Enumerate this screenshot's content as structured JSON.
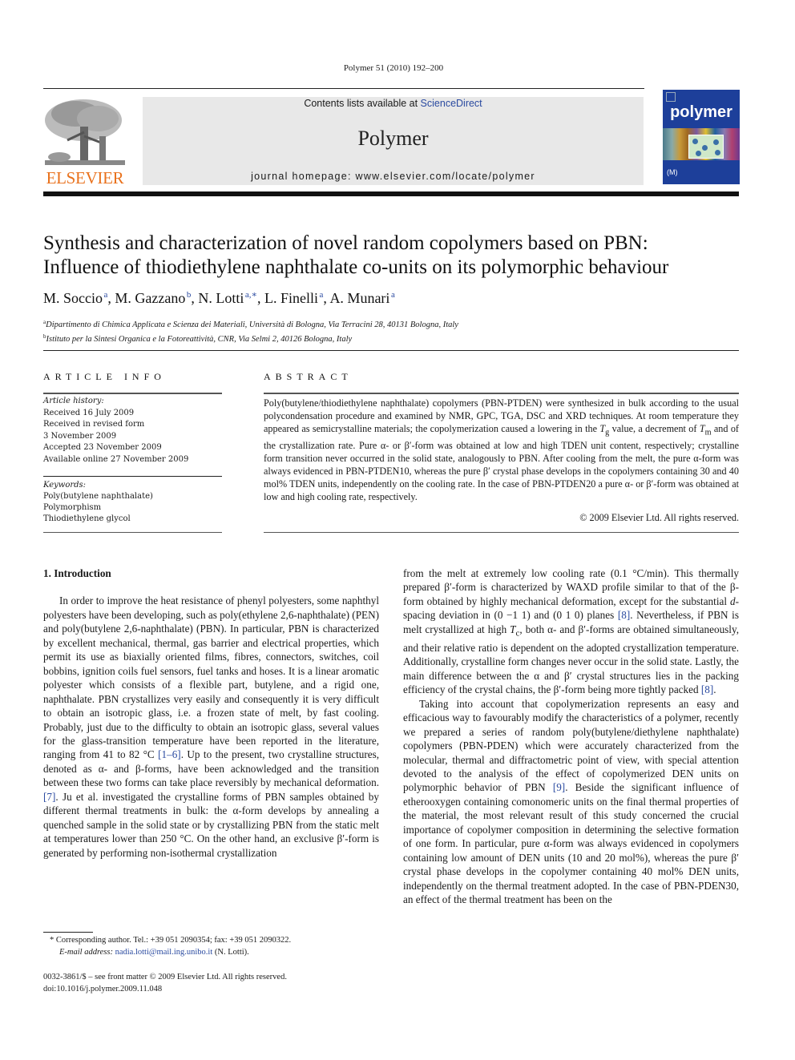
{
  "header": {
    "citation": "Polymer 51 (2010) 192–200",
    "contents_prefix": "Contents lists available at ",
    "contents_link": "ScienceDirect",
    "journal_name": "Polymer",
    "homepage": "journal homepage: www.elsevier.com/locate/polymer",
    "publisher_logo_text": "ELSEVIER",
    "cover_title": "polymer",
    "cover_foot": "(M)"
  },
  "colors": {
    "link": "#2a4aa0",
    "elsevier_orange": "#e9711c",
    "banner_bg": "#e8e8e8",
    "cover_blue": "#1d3f9a"
  },
  "article": {
    "title_line1": "Synthesis and characterization of novel random copolymers based on PBN:",
    "title_line2": "Influence of thiodiethylene naphthalate co-units on its polymorphic behaviour",
    "authors": [
      {
        "name": "M. Soccio",
        "aff": "a",
        "sep": ", "
      },
      {
        "name": "M. Gazzano",
        "aff": "b",
        "sep": ", "
      },
      {
        "name": "N. Lotti",
        "aff": "a,∗",
        "sep": ", "
      },
      {
        "name": "L. Finelli",
        "aff": "a",
        "sep": ", "
      },
      {
        "name": "A. Munari",
        "aff": "a",
        "sep": ""
      }
    ],
    "affiliations": [
      {
        "mark": "a",
        "text": "Dipartimento di Chimica Applicata e Scienza dei Materiali, Università di Bologna, Via Terracini 28, 40131 Bologna, Italy"
      },
      {
        "mark": "b",
        "text": "Istituto per la Sintesi Organica e la Fotoreattività, CNR, Via Selmi 2, 40126 Bologna, Italy"
      }
    ]
  },
  "article_info": {
    "heading": "ARTICLE INFO",
    "history_label": "Article history:",
    "history": [
      "Received 16 July 2009",
      "Received in revised form",
      "3 November 2009",
      "Accepted 23 November 2009",
      "Available online 27 November 2009"
    ],
    "keywords_label": "Keywords:",
    "keywords": [
      "Poly(butylene naphthalate)",
      "Polymorphism",
      "Thiodiethylene glycol"
    ]
  },
  "abstract": {
    "heading": "ABSTRACT",
    "text_1": "Poly(butylene/thiodiethylene naphthalate) copolymers (PBN-PTDEN) were synthesized in bulk according to the usual polycondensation procedure and examined by NMR, GPC, TGA, DSC and XRD techniques. At room temperature they appeared as semicrystalline materials; the copolymerization caused a lowering in the ",
    "tg": "T",
    "tg_sub": "g",
    "text_2": " value, a decrement of ",
    "tm": "T",
    "tm_sub": "m",
    "text_3": " and of the crystallization rate. Pure α- or β′-form was obtained at low and high TDEN unit content, respectively; crystalline form transition never occurred in the solid state, analogously to PBN. After cooling from the melt, the pure α-form was always evidenced in PBN-PTDEN10, whereas the pure β′ crystal phase develops in the copolymers containing 30 and 40 mol% TDEN units, independently on the cooling rate. In the case of PBN-PTDEN20 a pure α- or β′-form was obtained at low and high cooling rate, respectively.",
    "copyright": "© 2009 Elsevier Ltd. All rights reserved."
  },
  "body": {
    "section_heading": "1.  Introduction",
    "left_p1_a": "In order to improve the heat resistance of phenyl polyesters, some naphthyl polyesters have been developing, such as poly(ethylene 2,6-naphthalate) (PEN) and poly(butylene 2,6-naphthalate) (PBN). In particular, PBN is characterized by excellent mechanical, thermal, gas barrier and electrical properties, which permit its use as biaxially oriented films, fibres, connectors, switches, coil bobbins, ignition coils fuel sensors, fuel tanks and hoses. It is a linear aromatic polyester which consists of a flexible part, butylene, and a rigid one, naphthalate. PBN crystallizes very easily and consequently it is very difficult to obtain an isotropic glass, i.e. a frozen state of melt, by fast cooling. Probably, just due to the difficulty to obtain an isotropic glass, several values for the glass-transition temperature have been reported in the literature, ranging from 41 to 82 °C ",
    "ref_1_6": "[1–6]",
    "left_p1_b": ". Up to the present, two crystalline structures, denoted as α- and β-forms, have been acknowledged and the transition between these two forms can take place reversibly by mechanical deformation. ",
    "ref_7": "[7]",
    "left_p1_c": ". Ju et al. investigated the crystalline forms of PBN samples obtained by different thermal treatments in bulk: the α-form develops by annealing a quenched sample in the solid state or by crystallizing PBN from the static melt at temperatures lower than 250 °C. On the other hand, an exclusive β′-form is generated by performing non-isothermal crystallization",
    "right_p1_a": "from the melt at extremely low cooling rate (0.1 °C/min). This thermally prepared β′-form is characterized by WAXD profile similar to that of the β-form obtained by highly mechanical deformation, except for the substantial ",
    "d_italic": "d",
    "right_p1_b": "-spacing deviation in (0 −1 1) and (0 1 0) planes ",
    "ref_8a": "[8]",
    "right_p1_c": ". Nevertheless, if PBN is melt crystallized at high ",
    "tc": "T",
    "tc_sub": "c",
    "right_p1_d": ", both α- and β′-forms are obtained simultaneously, and their relative ratio is dependent on the adopted crystallization temperature. Additionally, crystalline form changes never occur in the solid state. Lastly, the main difference between the α and β′ crystal structures lies in the packing efficiency of the crystal chains, the β′-form being more tightly packed ",
    "ref_8b": "[8]",
    "right_p1_e": ".",
    "right_p2_a": "Taking into account that copolymerization represents an easy and efficacious way to favourably modify the characteristics of a polymer, recently we prepared a series of random poly(butylene/diethylene naphthalate) copolymers (PBN-PDEN) which were accurately characterized from the molecular, thermal and diffractometric point of view, with special attention devoted to the analysis of the effect of copolymerized DEN units on polymorphic behavior of PBN ",
    "ref_9": "[9]",
    "right_p2_b": ". Beside the significant influence of etherooxygen containing comonomeric units on the final thermal properties of the material, the most relevant result of this study concerned the crucial importance of copolymer composition in determining the selective formation of one form. In particular, pure α-form was always evidenced in copolymers containing low amount of DEN units (10 and 20 mol%), whereas the pure β′ crystal phase develops in the copolymer containing 40 mol% DEN units, independently on the thermal treatment adopted. In the case of PBN-PDEN30, an effect of the thermal treatment has been on the"
  },
  "footnote": {
    "star": "*",
    "corresponding": " Corresponding author. Tel.: +39 051 2090354; fax: +39 051 2090322.",
    "email_label": "E-mail address: ",
    "email": "nadia.lotti@mail.ing.unibo.it",
    "email_suffix": " (N. Lotti).",
    "issn": "0032-3861/$ – see front matter © 2009 Elsevier Ltd. All rights reserved.",
    "doi": "doi:10.1016/j.polymer.2009.11.048"
  }
}
